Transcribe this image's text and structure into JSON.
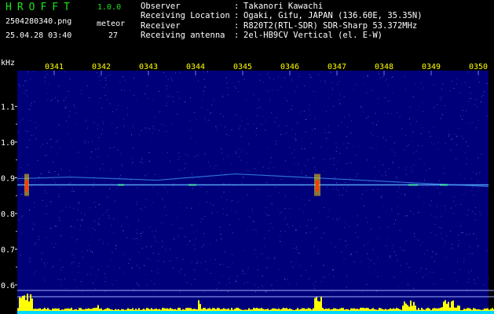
{
  "header": {
    "app_title": "HROFFT",
    "app_version": "1.0.0",
    "filename": "2504280340.png",
    "datetime": "25.04.28 03:40",
    "meteor_label": "meteor",
    "meteor_count": "27"
  },
  "info": [
    {
      "key": "Observer",
      "value": "Takanori Kawachi"
    },
    {
      "key": "Receiving Location",
      "value": "Ogaki, Gifu, JAPAN (136.60E, 35.35N)"
    },
    {
      "key": "Receiver",
      "value": "R820T2(RTL-SDR) SDR-Sharp 53.372MHz"
    },
    {
      "key": "Receiving antenna",
      "value": "2el-HB9CV Vertical (el. E-W)"
    }
  ],
  "chart_data": {
    "type": "heatmap",
    "yunit": "kHz",
    "x_ticks": [
      "0341",
      "0342",
      "0343",
      "0344",
      "0345",
      "0346",
      "0347",
      "0348",
      "0349",
      "0350"
    ],
    "y_ticks": [
      "1.1",
      "1.0",
      "0.9",
      "0.8",
      "0.7",
      "0.6"
    ],
    "ylim": [
      0.58,
      1.2
    ],
    "carrier_khz": 0.88,
    "colors": {
      "background": "#00007a",
      "noise": "#3c55ff",
      "carrier": "#5ab0ff",
      "echo_hot": "#ffd400",
      "echo_core": "#ff3b00",
      "level_bar": "#ffff00",
      "level_base": "#00d8ff",
      "axis_text": "#ffffff",
      "tick_text": "#ffff00"
    }
  }
}
